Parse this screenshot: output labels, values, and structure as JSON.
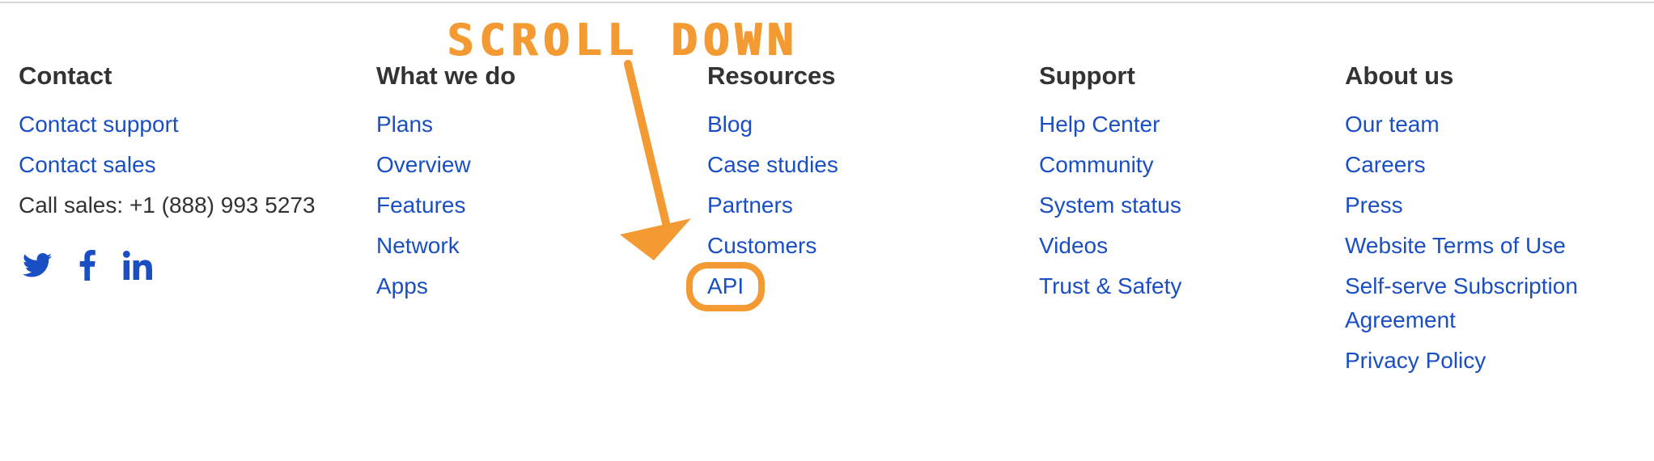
{
  "annotation": {
    "text": "SCROLL DOWN",
    "color": "#f39a32"
  },
  "link_color": "#1a4fc4",
  "heading_color": "#333333",
  "contact": {
    "heading": "Contact",
    "links": [
      "Contact support",
      "Contact sales"
    ],
    "phone_text": "Call sales: +1 (888) 993 5273",
    "social_icons": [
      "twitter-icon",
      "facebook-icon",
      "linkedin-icon"
    ]
  },
  "what_we_do": {
    "heading": "What we do",
    "links": [
      "Plans",
      "Overview",
      "Features",
      "Network",
      "Apps"
    ]
  },
  "resources": {
    "heading": "Resources",
    "links": [
      "Blog",
      "Case studies",
      "Partners",
      "Customers",
      "API"
    ],
    "highlighted": "API"
  },
  "support": {
    "heading": "Support",
    "links": [
      "Help Center",
      "Community",
      "System status",
      "Videos",
      "Trust & Safety"
    ]
  },
  "about_us": {
    "heading": "About us",
    "links": [
      "Our team",
      "Careers",
      "Press",
      "Website Terms of Use",
      "Self-serve Subscription Agreement",
      "Privacy Policy"
    ]
  }
}
